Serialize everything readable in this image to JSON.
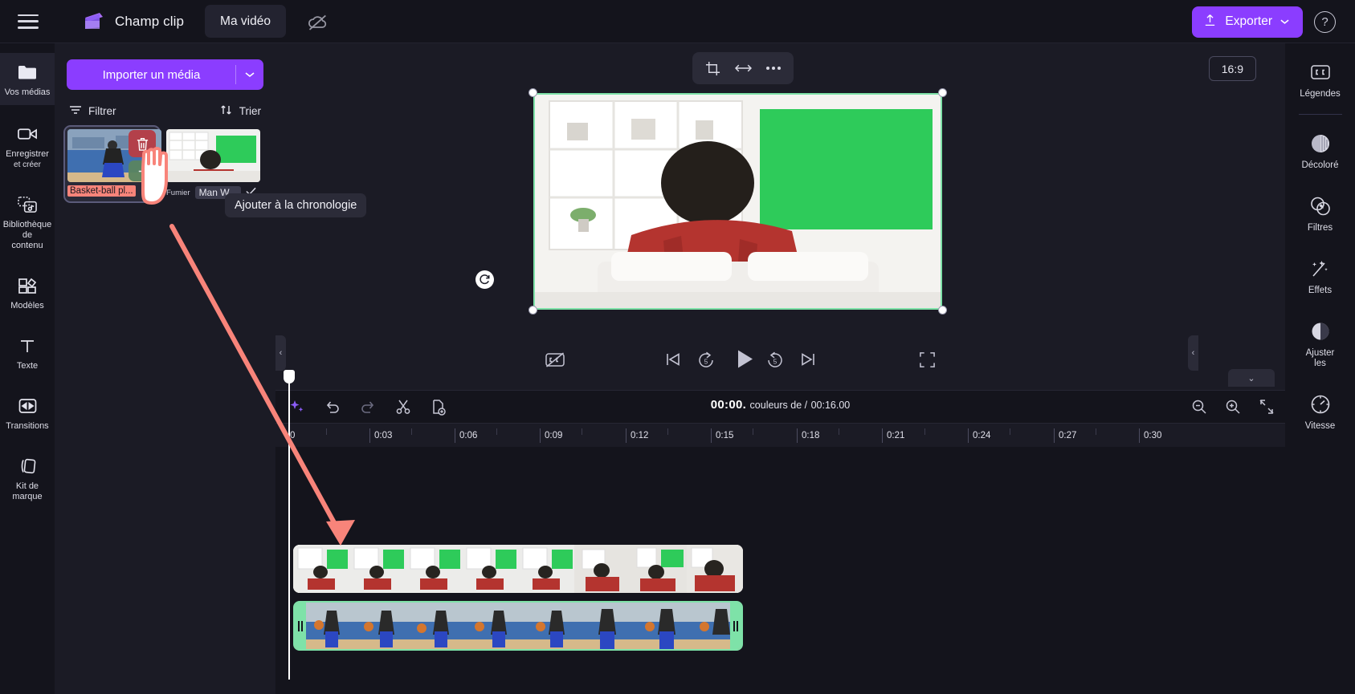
{
  "topbar": {
    "menu_icon": "hamburger-icon",
    "brand": "Champ clip",
    "project_tab": "Ma vidéo",
    "cloud_icon": "cloud-off-icon",
    "export_label": "Exporter",
    "export_icon": "upload-icon",
    "help_icon": "help-circle-icon",
    "accent": "#8b3dff"
  },
  "left_rail": {
    "items": [
      {
        "label": "Vos médias",
        "icon": "folder-icon",
        "active": true
      },
      {
        "label": "Enregistrer\net créer",
        "line1": "Enregistrer",
        "line2": "et créer",
        "icon": "camera-icon",
        "active": false
      },
      {
        "label": "Bibliothèque de contenu",
        "line1": "Bibliothèque de",
        "line2": "contenu",
        "icon": "content-library-icon",
        "active": false
      },
      {
        "label": "Modèles",
        "line1": "Modèles",
        "line2": "",
        "icon": "templates-icon",
        "active": false
      },
      {
        "label": "Texte",
        "line1": "Texte",
        "line2": "",
        "icon": "text-icon",
        "active": false
      },
      {
        "label": "Transitions",
        "line1": "Transitions",
        "line2": "",
        "icon": "transitions-icon",
        "active": false
      },
      {
        "label": "Kit de marque",
        "line1": "Kit de marque",
        "line2": "",
        "icon": "brand-kit-icon",
        "active": false
      }
    ]
  },
  "media_panel": {
    "import_label": "Importer un média",
    "import_caret_icon": "chevron-down-icon",
    "filter_label": "Filtrer",
    "filter_icon": "filter-icon",
    "sort_label": "Trier",
    "sort_icon": "sort-arrows-icon",
    "tooltip": "Ajouter à la chronologie",
    "items": [
      {
        "name": "Basket-ball pl...",
        "selected": true,
        "delete_icon": "trash-icon",
        "add_icon": "plus-icon"
      },
      {
        "name": "Man W...",
        "meta_prefix": "Fumier",
        "check_icon": "check-icon",
        "selected": false
      }
    ]
  },
  "preview": {
    "toolbar": [
      {
        "icon": "crop-icon",
        "name": "crop-button"
      },
      {
        "icon": "flip-horizontal-icon",
        "name": "flip-button"
      },
      {
        "icon": "more-horizontal-icon",
        "name": "more-button"
      }
    ],
    "aspect_ratio": "16:9",
    "rotate_icon": "rotate-icon",
    "controls": [
      {
        "icon": "captions-off-icon",
        "name": "captions-toggle"
      },
      {
        "icon": "skip-start-icon",
        "name": "jump-to-start"
      },
      {
        "icon": "rewind-5-icon",
        "name": "rewind-5-seconds",
        "label": "5"
      },
      {
        "icon": "play-icon",
        "name": "play-button"
      },
      {
        "icon": "forward-5-icon",
        "name": "forward-5-seconds",
        "label": "5"
      },
      {
        "icon": "skip-end-icon",
        "name": "jump-to-end"
      },
      {
        "icon": "fullscreen-icon",
        "name": "fullscreen-button"
      }
    ]
  },
  "timeline": {
    "tools": [
      {
        "icon": "magic-sparkle-icon",
        "name": "ai-tools-button"
      },
      {
        "icon": "undo-icon",
        "name": "undo-button"
      },
      {
        "icon": "redo-icon",
        "name": "redo-button"
      },
      {
        "icon": "scissors-icon",
        "name": "split-button"
      },
      {
        "icon": "duplicate-icon",
        "name": "duplicate-button"
      }
    ],
    "current_time": "00:00.",
    "middle_text": "couleurs de /",
    "total_time": "00:16.00",
    "zoom_out_icon": "zoom-out-icon",
    "zoom_in_icon": "zoom-in-icon",
    "fit_icon": "fit-timeline-icon",
    "ruler_ticks": [
      "0",
      "0:03",
      "0:06",
      "0:09",
      "0:12",
      "0:15",
      "0:18",
      "0:21",
      "0:24",
      "0:27",
      "0:30"
    ],
    "playhead_position": "0",
    "clips": [
      {
        "name": "green-screen-clip",
        "selected": false,
        "track": 0
      },
      {
        "name": "basketball-clip",
        "selected": true,
        "track": 1
      }
    ]
  },
  "right_rail": {
    "items": [
      {
        "label": "Légendes",
        "line1": "Légendes",
        "line2": "",
        "icon": "captions-cc-icon",
        "divider_after": true
      },
      {
        "label": "Décoloré",
        "line1": "Décoloré",
        "line2": "",
        "icon": "fade-icon",
        "divider_after": false
      },
      {
        "label": "Filtres",
        "line1": "Filtres",
        "line2": "",
        "icon": "filters-icon",
        "divider_after": false
      },
      {
        "label": "Effets",
        "line1": "Effets",
        "line2": "",
        "icon": "effects-wand-icon",
        "divider_after": false
      },
      {
        "label": "Ajuster les",
        "line1": "Ajuster",
        "line2": "les",
        "icon": "adjust-contrast-icon",
        "divider_after": false
      },
      {
        "label": "Vitesse",
        "line1": "Vitesse",
        "line2": "",
        "icon": "speed-gauge-icon",
        "divider_after": false
      }
    ]
  },
  "colors": {
    "accent": "#8b3dff",
    "selection_green": "#7ee2a8",
    "annotation_red": "#f8847a",
    "panel_bg": "#1b1b25",
    "app_bg": "#14141c"
  }
}
